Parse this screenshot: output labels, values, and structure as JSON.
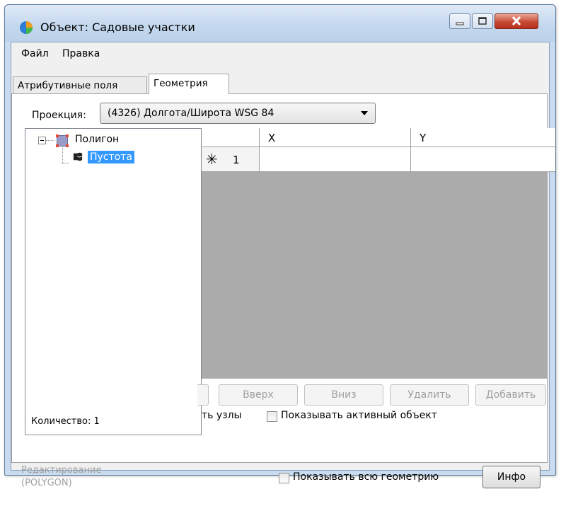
{
  "window": {
    "title": "Объект: Садовые участки"
  },
  "menu": {
    "items": [
      "Файл",
      "Правка"
    ]
  },
  "tabs": [
    {
      "label": "Атрибутивные поля",
      "active": false
    },
    {
      "label": "Геометрия",
      "active": true
    }
  ],
  "projection": {
    "label": "Проекция:",
    "value": "(4326) Долгота/Широта WSG 84"
  },
  "tree": {
    "root_label": "Полигон",
    "child_label": "Пустота",
    "count_label": "Количество: 1"
  },
  "grid": {
    "columns": [
      "X",
      "Y"
    ],
    "rows": [
      {
        "marker": "✳",
        "number": "1",
        "x": "",
        "y": ""
      }
    ]
  },
  "buttons": {
    "up": "Вверх",
    "down": "Вниз",
    "delete": "Удалить",
    "add": "Добавить"
  },
  "checks": {
    "nodes_partial": "ть узлы",
    "show_active": "Показывать активный объект",
    "show_all": "Показывать всю геометрию"
  },
  "status": {
    "line1": "Редактирование",
    "line2": "(POLYGON)"
  },
  "info_button": "Инфо",
  "colors": {
    "selection": "#3399ff",
    "grid_background": "#ababab",
    "close_button": "#c74a34"
  }
}
